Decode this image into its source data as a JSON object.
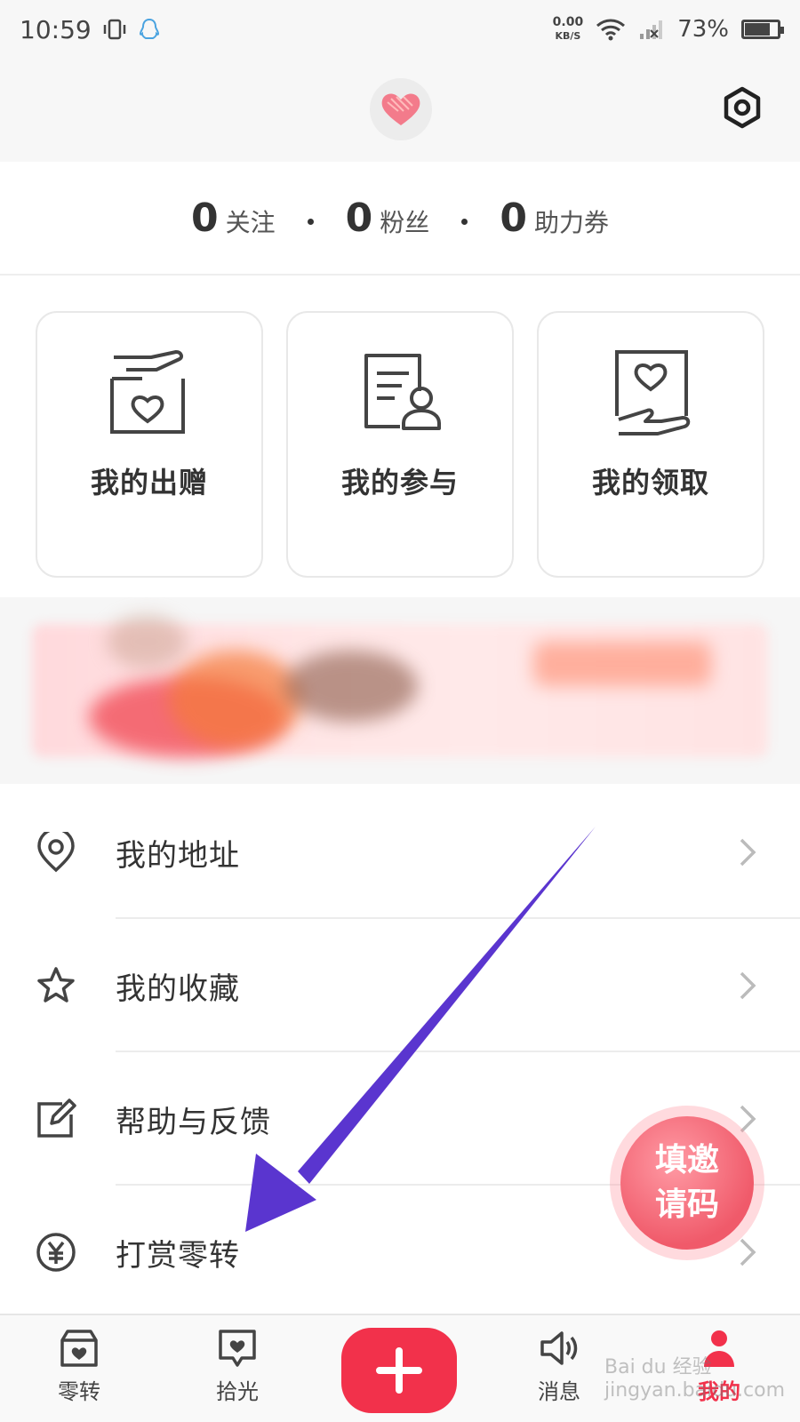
{
  "status_bar": {
    "time": "10:59",
    "speed_value": "0.00",
    "speed_unit": "KB/S",
    "battery": "73%",
    "battery_level": 0.73
  },
  "stats": [
    {
      "num": "0",
      "label": "关注"
    },
    {
      "num": "0",
      "label": "粉丝"
    },
    {
      "num": "0",
      "label": "助力券"
    }
  ],
  "cards": [
    {
      "label": "我的出赠",
      "icon": "gift-box-hand-icon"
    },
    {
      "label": "我的参与",
      "icon": "document-person-icon"
    },
    {
      "label": "我的领取",
      "icon": "heart-frame-hand-icon"
    }
  ],
  "menu": [
    {
      "label": "我的地址",
      "icon": "location-pin-icon"
    },
    {
      "label": "我的收藏",
      "icon": "star-icon"
    },
    {
      "label": "帮助与反馈",
      "icon": "edit-feedback-icon"
    },
    {
      "label": "打赏零转",
      "icon": "yen-coin-icon"
    }
  ],
  "invite": {
    "line1": "填邀",
    "line2": "请码"
  },
  "nav": [
    {
      "label": "零转",
      "icon": "box-heart-icon",
      "active": false
    },
    {
      "label": "拾光",
      "icon": "chat-heart-icon",
      "active": false
    },
    {
      "label": "我的",
      "icon": "person-icon",
      "active": true
    }
  ],
  "nav_extra": {
    "label": "消息",
    "icon": "speaker-icon"
  },
  "watermark": "Bai du 经验 jingyan.baidu.com",
  "colors": {
    "accent": "#f2314b",
    "arrow": "#5a35cf",
    "invite": "#f05a6a"
  }
}
